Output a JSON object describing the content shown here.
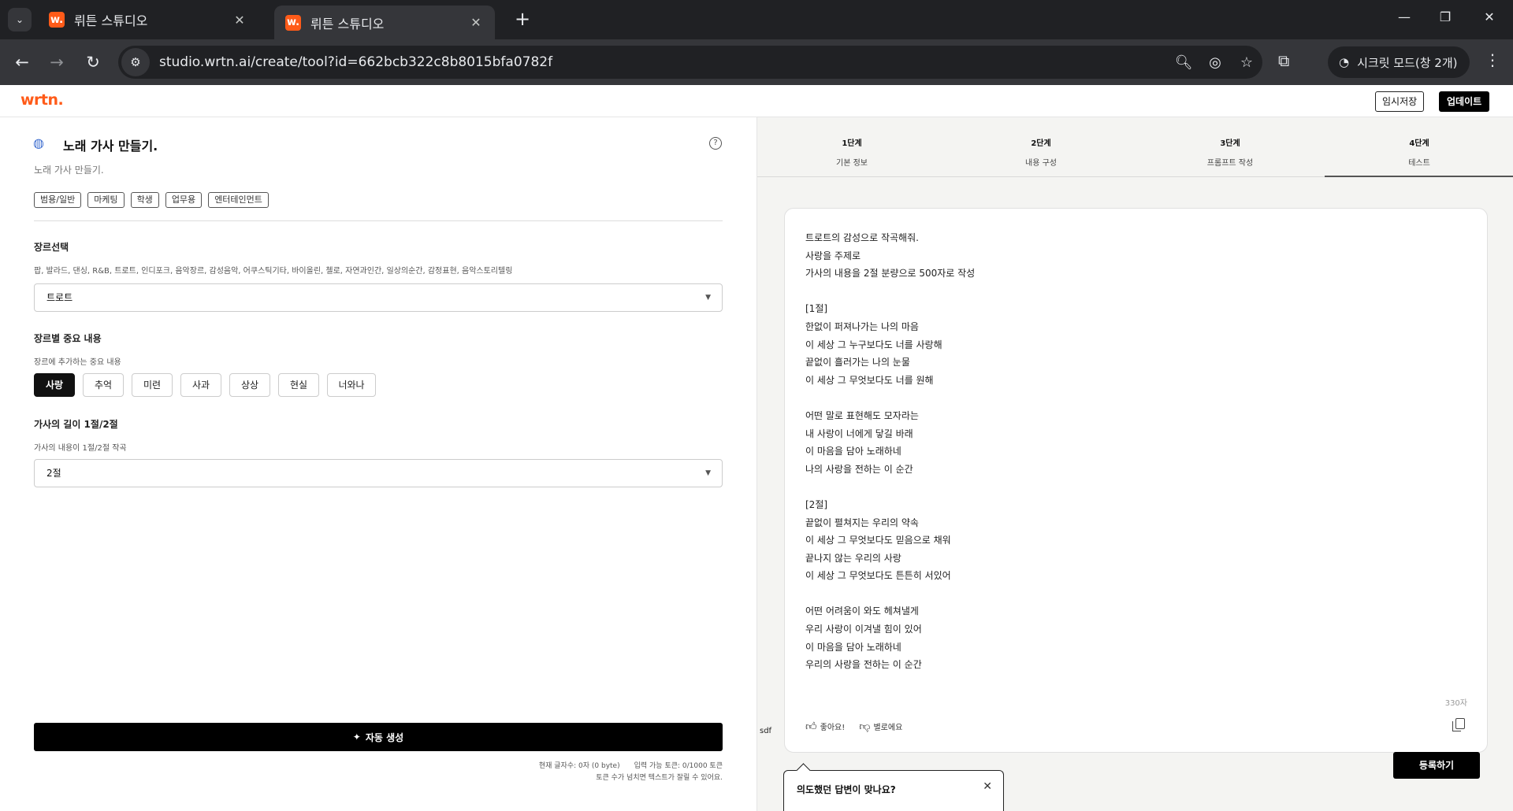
{
  "browser": {
    "tabs": [
      {
        "title": "뤼튼 스튜디오",
        "favicon": "w."
      },
      {
        "title": "뤼튼 스튜디오",
        "favicon": "w."
      }
    ],
    "url": "studio.wrtn.ai/create/tool?id=662bcb322c8b8015bfa0782f",
    "incognito_label": "시크릿 모드(창 2개)"
  },
  "app": {
    "logo": "wrtn.",
    "save_label": "임시저장",
    "update_label": "업데이트",
    "brand_color": "#ff5b19"
  },
  "tool": {
    "title": "노래 가사 만들기.",
    "description": "노래 가사 만들기.",
    "tags": [
      "범용/일반",
      "마케팅",
      "학생",
      "업무용",
      "엔터테인먼트"
    ]
  },
  "form": {
    "genre": {
      "title": "장르선택",
      "subtitle": "팝, 발라드, 댄싱, R&B, 트로트, 인디포크, 음악장르, 감성음악, 어쿠스틱기타, 바이올린, 첼로, 자연과인간, 일상의순간, 감정표현, 음악스토리텔링",
      "value": "트로트"
    },
    "keypoint": {
      "title": "장르별 중요 내용",
      "subtitle": "장르에 추가하는 중요 내용",
      "options": [
        "사랑",
        "추억",
        "미련",
        "사과",
        "상상",
        "현실",
        "너와나"
      ],
      "selected": "사랑"
    },
    "length": {
      "title": "가사의 길이 1절/2절",
      "subtitle": "가사의 내용이 1절/2절 작곡",
      "value": "2절"
    },
    "generate_label": "자동 생성",
    "count_label": "현재 글자수: 0자 (0 byte)",
    "token_label": "입력 가능 토큰: 0/1000 토큰",
    "token_warning": "토큰 수가 넘치면 텍스트가 잘릴 수 있어요."
  },
  "steps": [
    {
      "num": "1단계",
      "label": "기본 정보"
    },
    {
      "num": "2단계",
      "label": "내용 구성"
    },
    {
      "num": "3단계",
      "label": "프롬프트 작성"
    },
    {
      "num": "4단계",
      "label": "테스트"
    }
  ],
  "active_step": 3,
  "result": {
    "text": "트로트의 감성으로 작곡해줘.\n사랑을 주제로\n가사의 내용을 2절 분량으로 500자로 작성\n\n[1절]\n한없이 퍼져나가는 나의 마음\n이 세상 그 누구보다도 너를 사랑해\n끝없이 흘러가는 나의 눈물\n이 세상 그 무엇보다도 너를 원해\n\n어떤 말로 표현해도 모자라는\n내 사랑이 너에게 닿길 바래\n이 마음을 담아 노래하네\n나의 사랑을 전하는 이 순간\n\n[2절]\n끝없이 펼쳐지는 우리의 약속\n이 세상 그 무엇보다도 믿음으로 채워\n끝나지 않는 우리의 사랑\n이 세상 그 무엇보다도 튼튼히 서있어\n\n어떤 어려움이 와도 헤쳐낼게\n우리 사랑이 이겨낼 힘이 있어\n이 마음을 담아 노래하네\n우리의 사랑을 전하는 이 순간",
    "char_count": "330자",
    "like_label": "좋아요!",
    "dislike_label": "별로에요",
    "note": "sdf",
    "register_label": "등록하기",
    "popover_text": "의도했던 답변이 맞나요?"
  }
}
